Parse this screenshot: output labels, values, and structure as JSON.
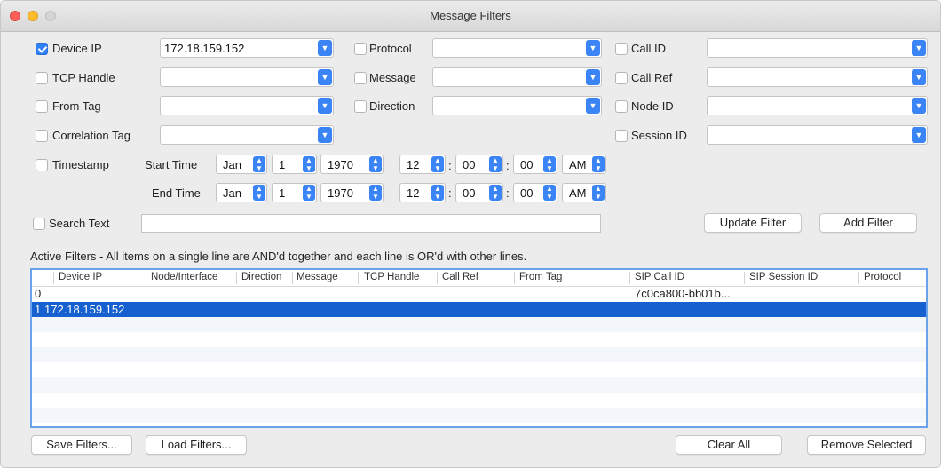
{
  "window": {
    "title": "Message Filters"
  },
  "filters": {
    "device_ip": {
      "label": "Device IP",
      "checked": true,
      "value": "172.18.159.152"
    },
    "protocol": {
      "label": "Protocol",
      "checked": false,
      "value": ""
    },
    "call_id": {
      "label": "Call ID",
      "checked": false,
      "value": ""
    },
    "tcp_handle": {
      "label": "TCP Handle",
      "checked": false,
      "value": ""
    },
    "message": {
      "label": "Message",
      "checked": false,
      "value": ""
    },
    "call_ref": {
      "label": "Call Ref",
      "checked": false,
      "value": ""
    },
    "from_tag": {
      "label": "From Tag",
      "checked": false,
      "value": ""
    },
    "direction": {
      "label": "Direction",
      "checked": false,
      "value": ""
    },
    "node_id": {
      "label": "Node ID",
      "checked": false,
      "value": ""
    },
    "correlation_tag": {
      "label": "Correlation Tag",
      "checked": false,
      "value": ""
    },
    "session_id": {
      "label": "Session ID",
      "checked": false,
      "value": ""
    }
  },
  "timestamp": {
    "label": "Timestamp",
    "checked": false,
    "start_label": "Start Time",
    "end_label": "End Time",
    "start": {
      "month": "Jan",
      "day": "1",
      "year": "1970",
      "hour": "12",
      "minute": "00",
      "second": "00",
      "ampm": "AM"
    },
    "end": {
      "month": "Jan",
      "day": "1",
      "year": "1970",
      "hour": "12",
      "minute": "00",
      "second": "00",
      "ampm": "AM"
    }
  },
  "search": {
    "label": "Search Text",
    "checked": false,
    "value": ""
  },
  "buttons": {
    "update_filter": "Update Filter",
    "add_filter": "Add Filter",
    "save_filters": "Save Filters...",
    "load_filters": "Load Filters...",
    "clear_all": "Clear All",
    "remove_selected": "Remove Selected"
  },
  "active_filters": {
    "caption": "Active Filters - All items on a single line are AND'd together and each line is OR'd with other lines.",
    "columns": [
      "Device IP",
      "Node/Interface",
      "Direction",
      "Message",
      "TCP Handle",
      "Call Ref",
      "From Tag",
      "SIP Call ID",
      "SIP Session ID",
      "Protocol"
    ],
    "rows": [
      {
        "index": "0",
        "device_ip": "",
        "sip_call_id": "7c0ca800-bb01b...",
        "selected": false
      },
      {
        "index": "1",
        "device_ip": "172.18.159.152",
        "sip_call_id": "",
        "selected": true
      }
    ]
  },
  "colors": {
    "accent": "#3b84f5",
    "selection": "#1660d0",
    "table_border": "#6aa2ec"
  },
  "icons": {
    "dropdown": "chevron-down-icon",
    "stepper": "stepper-arrows-icon",
    "check": "checkmark-icon"
  }
}
